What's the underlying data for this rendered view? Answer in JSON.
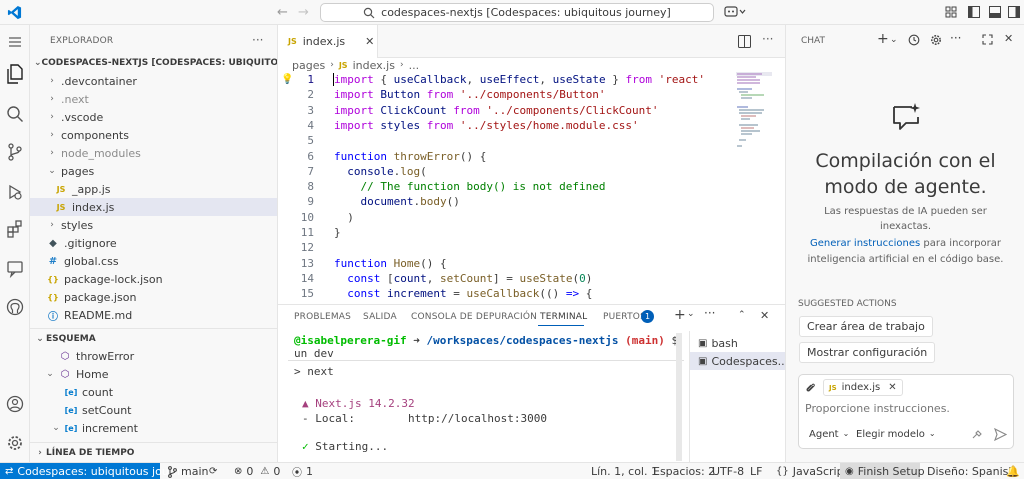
{
  "search": {
    "text": "codespaces-nextjs [Codespaces: ubiquitous journey]"
  },
  "explorer": {
    "title": "EXPLORADOR",
    "root": "CODESPACES-NEXTJS [CODESPACES: UBIQUITOUS J...",
    "items": [
      {
        "label": ".devcontainer"
      },
      {
        "label": ".next"
      },
      {
        "label": ".vscode"
      },
      {
        "label": "components"
      },
      {
        "label": "node_modules"
      },
      {
        "label": "pages"
      },
      {
        "label": "_app.js"
      },
      {
        "label": "index.js"
      },
      {
        "label": "styles"
      },
      {
        "label": ".gitignore"
      },
      {
        "label": "global.css"
      },
      {
        "label": "package-lock.json"
      },
      {
        "label": "package.json"
      },
      {
        "label": "README.md"
      }
    ]
  },
  "outline": {
    "title": "ESQUEMA",
    "items": [
      {
        "label": "throwError"
      },
      {
        "label": "Home"
      },
      {
        "label": "count"
      },
      {
        "label": "setCount"
      },
      {
        "label": "increment"
      }
    ]
  },
  "timeline": {
    "title": "LÍNEA DE TIEMPO"
  },
  "editor": {
    "tab": "index.js",
    "file_badge": "JS",
    "breadcrumb": [
      "pages",
      "index.js",
      "..."
    ],
    "line_numbers": [
      "1",
      "2",
      "3",
      "4",
      "5",
      "6",
      "7",
      "8",
      "9",
      "10",
      "11",
      "12",
      "13",
      "14",
      "15"
    ]
  },
  "code": {
    "l1": {
      "a": "import",
      "b": " { ",
      "c": "useCallback",
      "d": ", ",
      "e": "useEffect",
      "f": ", ",
      "g": "useState",
      "h": " } ",
      "i": "from",
      "j": " ",
      "k": "'react'"
    },
    "l2": {
      "a": "import",
      "b": " Button ",
      "c": "from",
      "d": " ",
      "e": "'../components/Button'"
    },
    "l3": {
      "a": "import",
      "b": " ClickCount ",
      "c": "from",
      "d": " ",
      "e": "'../components/ClickCount'"
    },
    "l4": {
      "a": "import",
      "b": " styles ",
      "c": "from",
      "d": " ",
      "e": "'../styles/home.module.css'"
    },
    "l6": {
      "a": "function",
      "b": " ",
      "c": "throwError",
      "d": "() {"
    },
    "l7": {
      "a": "  console",
      "b": ".",
      "c": "log",
      "d": "("
    },
    "l8": {
      "a": "    // The function body() is not defined"
    },
    "l9": {
      "a": "    document",
      "b": ".",
      "c": "body",
      "d": "()"
    },
    "l10": {
      "a": "  )"
    },
    "l11": {
      "a": "}"
    },
    "l13": {
      "a": "function",
      "b": " ",
      "c": "Home",
      "d": "() {"
    },
    "l14": {
      "a": "  ",
      "b": "const",
      "c": " [",
      "d": "count",
      "e": ", ",
      "f": "setCount",
      "g": "] = ",
      "h": "useState",
      "i": "(",
      "j": "0",
      "k": ")"
    },
    "l15": {
      "a": "  ",
      "b": "const",
      "c": " ",
      "d": "increment",
      "e": " = ",
      "f": "useCallback",
      "g": "(() ",
      "h": "=>",
      "i": " {"
    }
  },
  "panel": {
    "tabs": [
      "PROBLEMAS",
      "SALIDA",
      "CONSOLA DE DEPURACIÓN",
      "TERMINAL",
      "PUERTOS"
    ],
    "ports_badge": "1",
    "terminal": {
      "user": "@isabelperera-gif",
      "arrow": " ➜ ",
      "path": "/workspaces/codespaces-nextjs",
      "branch": " (main)",
      "cmd": " $ npm r",
      "wrap": "un dev",
      "l2": "> next",
      "l3a": "▲ Next.js 14.2.32",
      "l4a": "- Local:",
      "l4b": "        http://localhost:3000",
      "l5a": "✓ ",
      "l5b": "Starting..."
    },
    "terminals": [
      "bash",
      "Codespaces..."
    ]
  },
  "chat": {
    "title": "CHAT",
    "heading1": "Compilación con el",
    "heading2": "modo de agente.",
    "sub1": "Las respuestas de IA pueden ser",
    "sub2": "inexactas.",
    "link": "Generar instrucciones",
    "desc1": " para incorporar",
    "desc2": "inteligencia artificial en el código base.",
    "suggested_title": "SUGGESTED ACTIONS",
    "actions": [
      "Crear área de trabajo",
      "Mostrar configuración"
    ],
    "context_file": "index.js",
    "input_placeholder": "Proporcione instrucciones.",
    "mode": "Agent",
    "model": "Elegir modelo"
  },
  "status": {
    "remote": "Codespaces: ubiquitous journey",
    "branch": "main",
    "errors": "0",
    "warnings": "0",
    "ports": "1",
    "position": "Lín. 1, col. 1",
    "spaces": "Espacios: 2",
    "encoding": "UTF-8",
    "eol": "LF",
    "language": "JavaScript",
    "finish": "Finish Setup",
    "design": "Diseño: Spanish"
  },
  "colors": {
    "accent": "#005fb8",
    "remote_bg": "#0078d4",
    "js": "#c8a400",
    "json": "#c8a400",
    "css": "#1e7ec8",
    "md": "#1e7ec8"
  }
}
